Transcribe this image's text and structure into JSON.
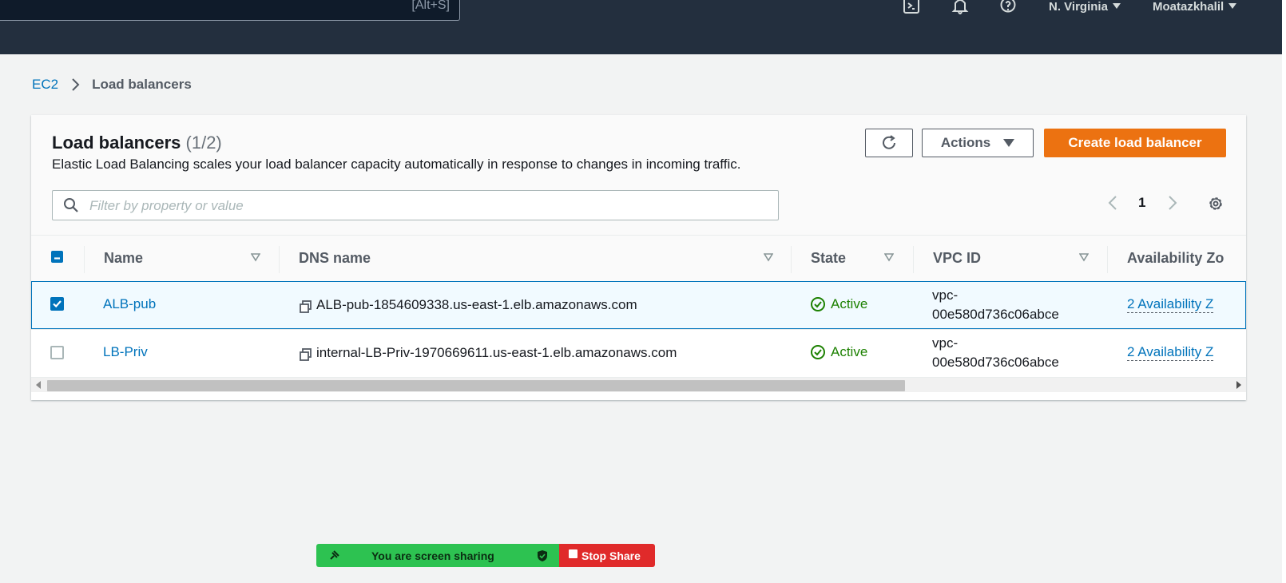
{
  "nav": {
    "search_shortcut": "[Alt+S]",
    "region": "N. Virginia",
    "user": "Moatazkhalil"
  },
  "breadcrumb": {
    "parent": "EC2",
    "current": "Load balancers"
  },
  "panel": {
    "title": "Load balancers",
    "count": "(1/2)",
    "description": "Elastic Load Balancing scales your load balancer capacity automatically in response to changes in incoming traffic.",
    "actions_label": "Actions",
    "create_label": "Create load balancer",
    "filter_placeholder": "Filter by property or value",
    "page_number": "1"
  },
  "table": {
    "columns": [
      "Name",
      "DNS name",
      "State",
      "VPC ID",
      "Availability Zo"
    ],
    "rows": [
      {
        "selected": true,
        "name": "ALB-pub",
        "dns": "ALB-pub-1854609338.us-east-1.elb.amazonaws.com",
        "state": "Active",
        "vpc_line1": "vpc-",
        "vpc_line2": "00e580d736c06abce",
        "az": "2 Availability Z"
      },
      {
        "selected": false,
        "name": "LB-Priv",
        "dns": "internal-LB-Priv-1970669611.us-east-1.elb.amazonaws.com",
        "state": "Active",
        "vpc_line1": "vpc-",
        "vpc_line2": "00e580d736c06abce",
        "az": "2 Availability Z"
      }
    ]
  },
  "sharing": {
    "message": "You are screen sharing",
    "stop_label": "Stop Share"
  },
  "colors": {
    "nav_bg": "#232f3e",
    "primary": "#ec7211",
    "link": "#0073bb",
    "success": "#1d8102",
    "share_green": "#2dc251",
    "share_red": "#e02a2a"
  },
  "icons": [
    "terminal-icon",
    "bell-icon",
    "help-icon",
    "refresh-icon",
    "search-icon",
    "settings-icon",
    "copy-icon",
    "status-ok-icon"
  ]
}
